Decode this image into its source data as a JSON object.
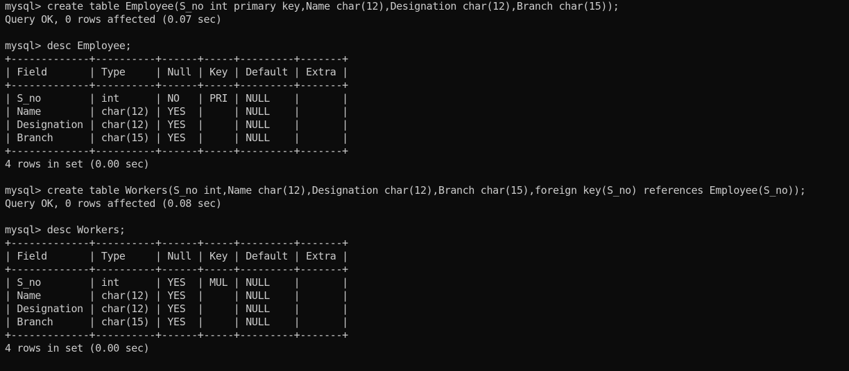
{
  "terminal": {
    "colors": {
      "background": "#0c0c0c",
      "foreground": "#cccccc"
    },
    "lines": [
      "mysql> create table Employee(S_no int primary key,Name char(12),Designation char(12),Branch char(15));",
      "Query OK, 0 rows affected (0.07 sec)",
      "",
      "mysql> desc Employee;",
      "+-------------+----------+------+-----+---------+-------+",
      "| Field       | Type     | Null | Key | Default | Extra |",
      "+-------------+----------+------+-----+---------+-------+",
      "| S_no        | int      | NO   | PRI | NULL    |       |",
      "| Name        | char(12) | YES  |     | NULL    |       |",
      "| Designation | char(12) | YES  |     | NULL    |       |",
      "| Branch      | char(15) | YES  |     | NULL    |       |",
      "+-------------+----------+------+-----+---------+-------+",
      "4 rows in set (0.00 sec)",
      "",
      "mysql> create table Workers(S_no int,Name char(12),Designation char(12),Branch char(15),foreign key(S_no) references Employee(S_no));",
      "Query OK, 0 rows affected (0.08 sec)",
      "",
      "mysql> desc Workers;",
      "+-------------+----------+------+-----+---------+-------+",
      "| Field       | Type     | Null | Key | Default | Extra |",
      "+-------------+----------+------+-----+---------+-------+",
      "| S_no        | int      | YES  | MUL | NULL    |       |",
      "| Name        | char(12) | YES  |     | NULL    |       |",
      "| Designation | char(12) | YES  |     | NULL    |       |",
      "| Branch      | char(15) | YES  |     | NULL    |       |",
      "+-------------+----------+------+-----+---------+-------+",
      "4 rows in set (0.00 sec)"
    ]
  }
}
